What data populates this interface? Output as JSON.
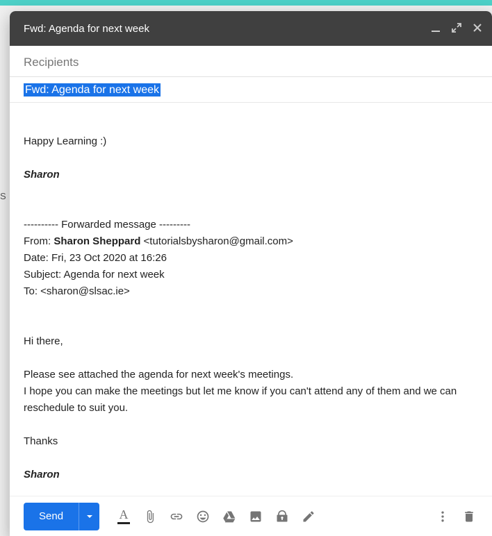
{
  "background": {
    "fragment": "S"
  },
  "window": {
    "title": "Fwd: Agenda for next week",
    "recipients_placeholder": "Recipients",
    "subject": "Fwd: Agenda for next week"
  },
  "body": {
    "greeting": "Happy Learning :)",
    "signature_top": "Sharon",
    "fwd_divider": "---------- Forwarded message ---------",
    "from_label": "From: ",
    "from_name": "Sharon Sheppard",
    "from_email": " <tutorialsbysharon@gmail.com>",
    "date_line": "Date: Fri, 23 Oct 2020 at 16:26",
    "subject_line": "Subject: Agenda for next week",
    "to_line": "To: <sharon@slsac.ie>",
    "hi": "Hi there,",
    "p1": "Please see attached the agenda for next week's meetings.",
    "p2": "I hope you can make the meetings but let me know if you can't attend any of them and we can reschedule to suit you.",
    "thanks": "Thanks",
    "signature_bottom": "Sharon"
  },
  "toolbar": {
    "send_label": "Send"
  }
}
